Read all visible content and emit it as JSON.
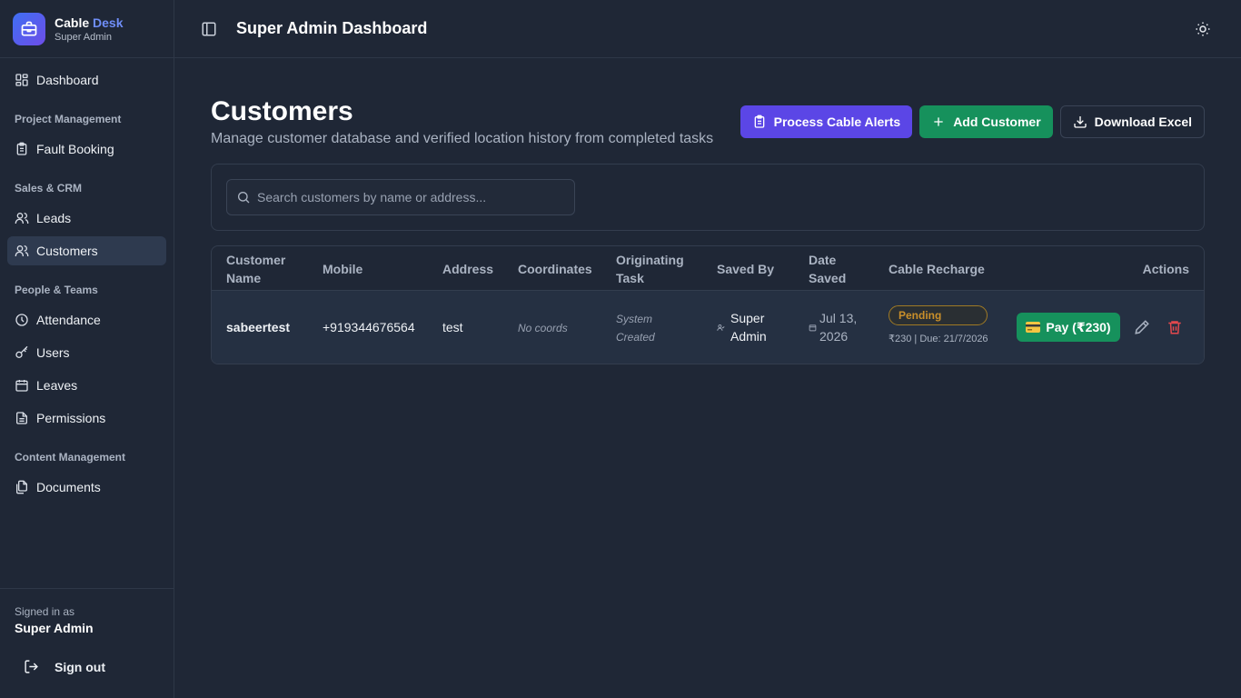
{
  "brand": {
    "name_part1": "Cable",
    "name_part2": "Desk",
    "role": "Super Admin"
  },
  "sidebar": {
    "dashboard": "Dashboard",
    "sections": {
      "project": "Project Management",
      "sales": "Sales & CRM",
      "people": "People & Teams",
      "content": "Content Management"
    },
    "items": {
      "fault_booking": "Fault Booking",
      "leads": "Leads",
      "customers": "Customers",
      "attendance": "Attendance",
      "users": "Users",
      "leaves": "Leaves",
      "permissions": "Permissions",
      "documents": "Documents"
    },
    "footer": {
      "signed_in_as": "Signed in as",
      "user_name": "Super Admin",
      "sign_out": "Sign out"
    }
  },
  "header": {
    "title": "Super Admin Dashboard"
  },
  "page": {
    "title": "Customers",
    "subtitle": "Manage customer database and verified location history from completed tasks",
    "buttons": {
      "process_alerts": "Process Cable Alerts",
      "add_customer": "Add Customer",
      "download_excel": "Download Excel"
    },
    "search": {
      "placeholder": "Search customers by name or address..."
    }
  },
  "table": {
    "headers": {
      "name_l1": "Customer",
      "name_l2": "Name",
      "mobile": "Mobile",
      "address": "Address",
      "coordinates": "Coordinates",
      "task_l1": "Originating",
      "task_l2": "Task",
      "saved_by": "Saved By",
      "date_l1": "Date",
      "date_l2": "Saved",
      "recharge": "Cable Recharge",
      "actions": "Actions"
    },
    "rows": [
      {
        "name": "sabeertest",
        "mobile": "+919344676564",
        "address": "test",
        "coordinates": "No coords",
        "task_l1": "System",
        "task_l2": "Created",
        "saved_by_l1": "Super",
        "saved_by_l2": "Admin",
        "date_l1": "Jul 13,",
        "date_l2": "2026",
        "recharge_status": "Pending",
        "recharge_detail": "₹230 | Due: 21/7/2026",
        "pay_label": "Pay (₹230)"
      }
    ]
  },
  "colors": {
    "accent_purple": "#5b46e6",
    "accent_green": "#16915c",
    "pending": "#c98f2a",
    "danger": "#e5484d"
  },
  "icons": [
    "briefcase-icon",
    "dashboard-icon",
    "clipboard-icon",
    "users-icon",
    "clock-icon",
    "key-icon",
    "calendar-icon",
    "document-icon",
    "documents-icon",
    "sign-out-icon",
    "panel-toggle-icon",
    "sun-icon",
    "plus-icon",
    "download-icon",
    "search-icon",
    "credit-card-icon",
    "pencil-icon",
    "trash-icon"
  ]
}
